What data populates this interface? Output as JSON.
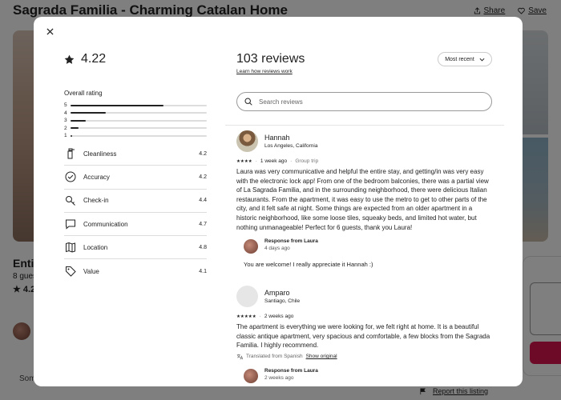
{
  "background": {
    "title": "Sagrada Familia - Charming Catalan Home",
    "share_label": "Share",
    "save_label": "Save",
    "heading_fragment": "Entir",
    "guests_fragment": "8 gues",
    "rating_fragment": "4.2",
    "some_fragment": "Som",
    "report_label": "Report this listing"
  },
  "modal": {
    "rating_value": "4.22",
    "overall_label": "Overall rating",
    "distribution": [
      {
        "stars": "5",
        "fraction": 0.68
      },
      {
        "stars": "4",
        "fraction": 0.26
      },
      {
        "stars": "3",
        "fraction": 0.11
      },
      {
        "stars": "2",
        "fraction": 0.06
      },
      {
        "stars": "1",
        "fraction": 0.01
      }
    ],
    "categories": [
      {
        "label": "Cleanliness",
        "value": "4.2",
        "icon": "spray-bottle-icon"
      },
      {
        "label": "Accuracy",
        "value": "4.2",
        "icon": "check-circle-icon"
      },
      {
        "label": "Check-in",
        "value": "4.4",
        "icon": "key-icon"
      },
      {
        "label": "Communication",
        "value": "4.7",
        "icon": "chat-bubble-icon"
      },
      {
        "label": "Location",
        "value": "4.8",
        "icon": "map-icon"
      },
      {
        "label": "Value",
        "value": "4.1",
        "icon": "tag-icon"
      }
    ],
    "reviews_count_label": "103 reviews",
    "learn_link": "Learn how reviews work",
    "sort_label": "Most recent",
    "search_placeholder": "Search reviews",
    "reviews": [
      {
        "name": "Hannah",
        "location": "Los Angeles, California",
        "stars": "★★★★",
        "date": "1 week ago",
        "trip": "Group trip",
        "text": "Laura was very communicative and helpful the entire stay, and getting/in was very easy with the electronic lock app! From one of the bedroom balconies, there was a partial view of La Sagrada Familia, and in the surrounding neighborhood, there were delicious Italian restaurants. From the apartment, it was easy to use the metro to get to other parts of the city, and it felt safe at night. Some things are expected from an older apartment in a historic neighborhood, like some loose tiles, squeaky beds, and limited hot water, but nothing unmanageable! Perfect for 6 guests, thank you Laura!",
        "response_title": "Response from Laura",
        "response_date": "4 days ago",
        "response_text": "You are welcome! I really appreciate it Hannah :)"
      },
      {
        "name": "Amparo",
        "location": "Santiago, Chile",
        "stars": "★★★★★",
        "date": "2 weeks ago",
        "text": "The apartment is everything we were looking for, we felt right at home. It is a beautiful classic antique apartment, very spacious and comfortable, a few blocks from the Sagrada Familia. I highly recommend.",
        "translated_label": "Translated from Spanish",
        "show_original": "Show original",
        "response_title": "Response from Laura",
        "response_date": "2 weeks ago"
      }
    ]
  }
}
